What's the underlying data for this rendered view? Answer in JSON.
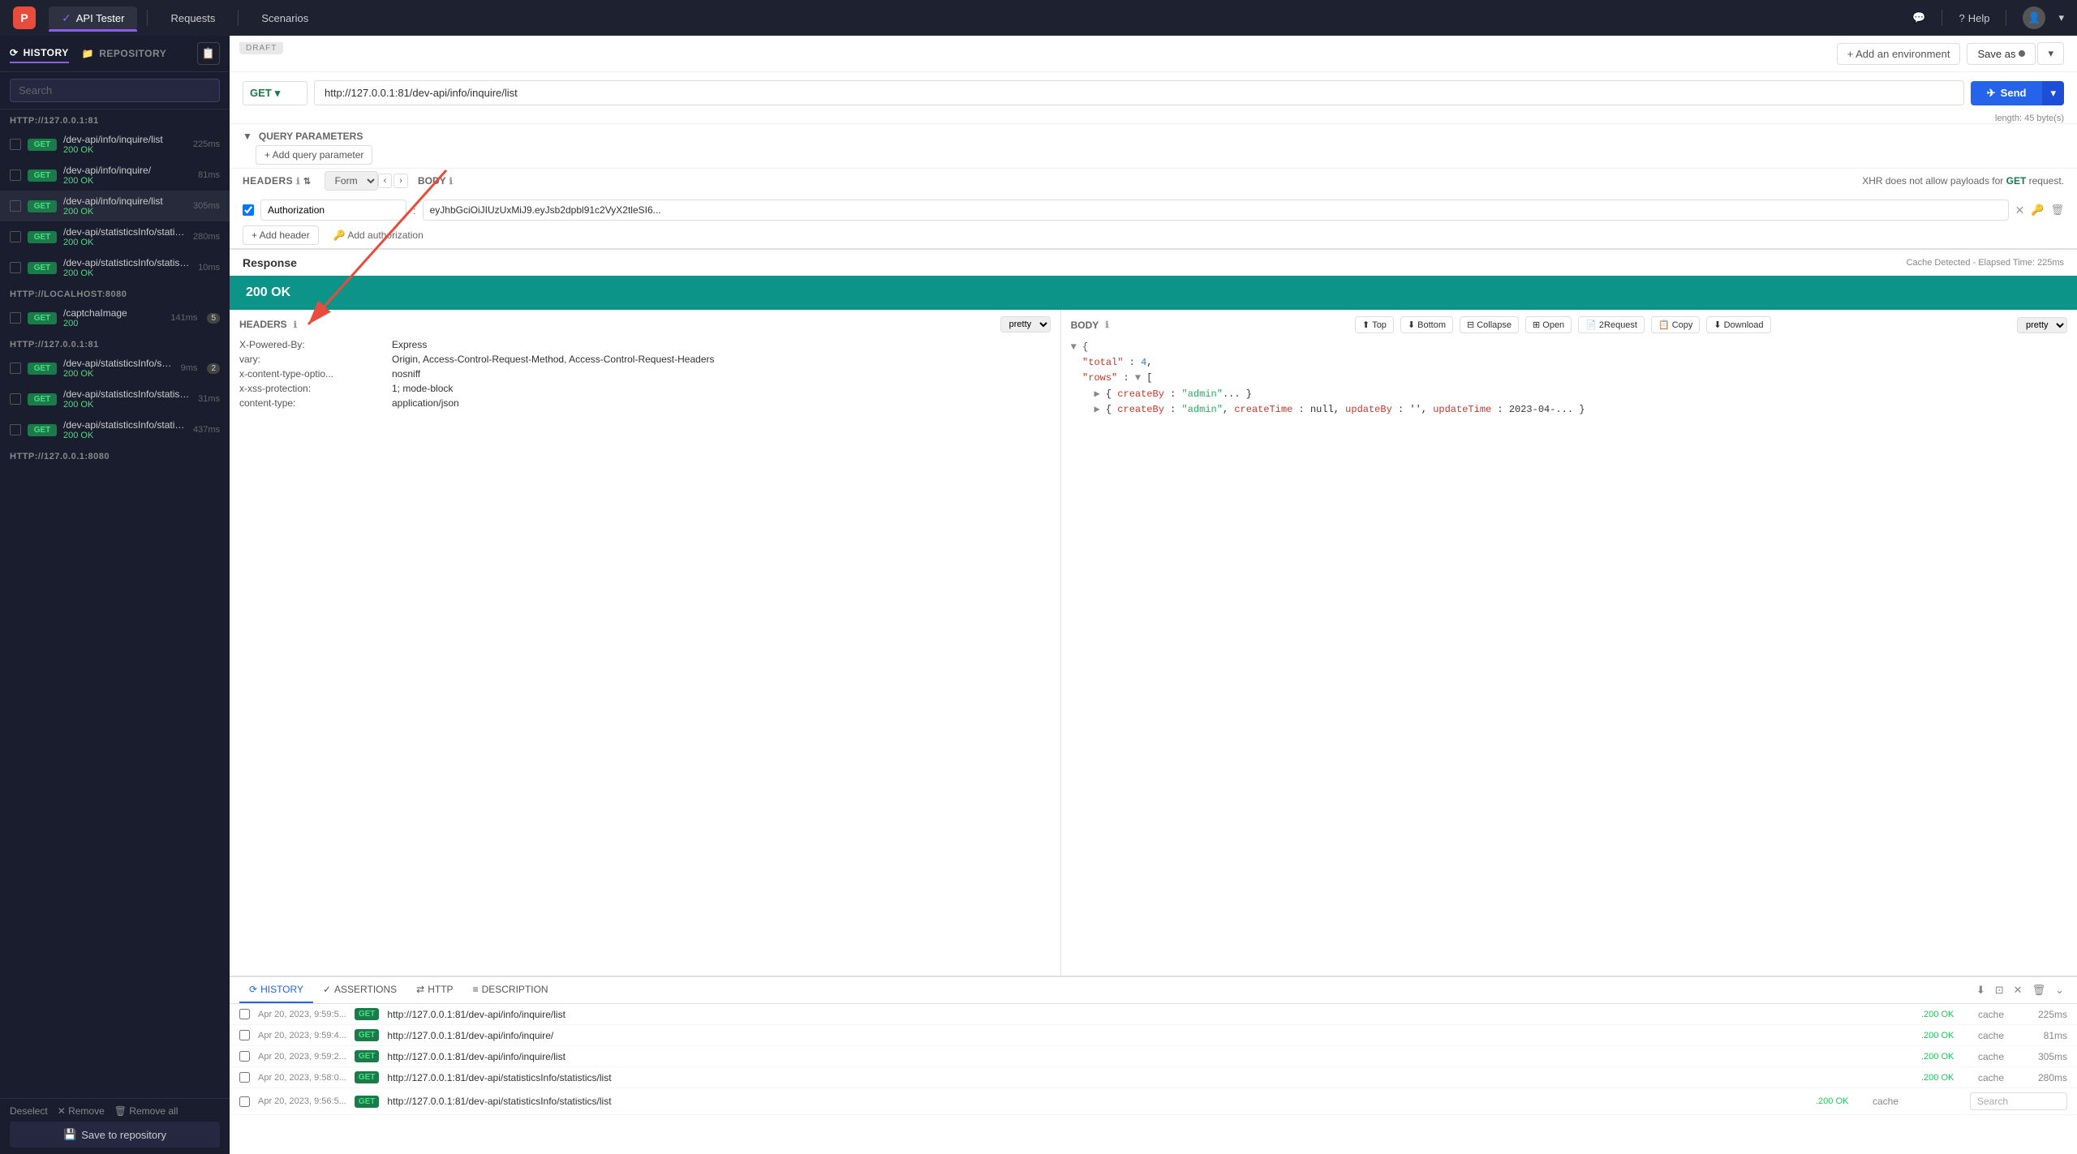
{
  "app": {
    "logo": "P",
    "nav_tabs": [
      {
        "id": "api-tester",
        "label": "API Tester",
        "active": true,
        "has_check": true
      },
      {
        "id": "requests",
        "label": "Requests",
        "active": false
      },
      {
        "id": "scenarios",
        "label": "Scenarios",
        "active": false
      }
    ],
    "nav_right": {
      "chat_icon": "💬",
      "help_label": "Help",
      "avatar_icon": "👤",
      "chevron": "▾"
    }
  },
  "sidebar": {
    "tabs": [
      {
        "id": "history",
        "label": "HISTORY",
        "active": true,
        "icon": "⟳"
      },
      {
        "id": "repository",
        "label": "REPOSITORY",
        "active": false,
        "icon": "📁"
      }
    ],
    "clipboard_icon": "📋",
    "search_placeholder": "Search",
    "groups": [
      {
        "header": "HTTP://127.0.0.1:81",
        "items": [
          {
            "path": "/dev-api/info/inquire/list",
            "method": "GET",
            "status": "200 OK",
            "time": "225ms",
            "checked": false
          },
          {
            "path": "/dev-api/info/inquire/",
            "method": "GET",
            "status": "200 OK",
            "time": "81ms",
            "checked": false
          },
          {
            "path": "/dev-api/info/inquire/list",
            "method": "GET",
            "status": "200 OK",
            "time": "305ms",
            "checked": false
          },
          {
            "path": "/dev-api/statisticsInfo/statistics/...",
            "method": "GET",
            "status": "200 OK",
            "time": "280ms",
            "checked": false
          },
          {
            "path": "/dev-api/statisticsInfo/statistics/...",
            "method": "GET",
            "status": "200 OK",
            "time": "10ms",
            "checked": false
          }
        ]
      },
      {
        "header": "HTTP://LOCALHOST:8080",
        "items": [
          {
            "path": "/captchaImage",
            "method": "GET",
            "status": "200",
            "time": "141ms",
            "badge": "5",
            "checked": false
          }
        ]
      },
      {
        "header": "HTTP://127.0.0.1:81",
        "items": [
          {
            "path": "/dev-api/statisticsInfo/statistics/...",
            "method": "GET",
            "status": "200 OK",
            "time": "9ms",
            "badge": "2",
            "checked": false
          },
          {
            "path": "/dev-api/statisticsInfo/statistics/...",
            "method": "GET",
            "status": "200 OK",
            "time": "31ms",
            "checked": false
          },
          {
            "path": "/dev-api/statisticsInfo/statistics/...",
            "method": "GET",
            "status": "200 OK",
            "time": "437ms",
            "checked": false
          }
        ]
      },
      {
        "header": "HTTP://127.0.0.1:8080",
        "items": []
      }
    ],
    "bottom_actions": {
      "deselect": "Deselect",
      "remove": "✕ Remove",
      "remove_all": "🗑 Remove all"
    },
    "save_to_repo_label": "Save to repository"
  },
  "request": {
    "draft_label": "DRAFT",
    "env_btn": "+ Add an environment",
    "save_as_label": "Save as",
    "method": "GET",
    "url": "http://127.0.0.1:81/dev-api/info/inquire/list",
    "url_length": "length: 45 byte(s)",
    "send_label": "Send",
    "query_params_label": "QUERY PARAMETERS",
    "add_query_param_label": "+ Add query parameter",
    "headers_label": "HEADERS",
    "form_label": "Form",
    "body_label": "BODY",
    "xhr_note": "XHR does not allow payloads for GET request.",
    "header_row": {
      "key": "Authorization",
      "value": "eyJhbGciOiJIUzUxMiJ9.eyJsb2dpbl91c2VyX2tleSI6..."
    },
    "add_header_label": "+ Add header",
    "add_authorization_label": "🔑 Add authorization"
  },
  "response": {
    "title": "Response",
    "cache_info": "Cache Detected - Elapsed Time: 225ms",
    "status_code": "200",
    "status_text": "OK",
    "headers_label": "HEADERS",
    "body_label": "BODY",
    "pretty_label": "pretty",
    "response_headers": [
      {
        "key": "X-Powered-By:",
        "value": "Express"
      },
      {
        "key": "vary:",
        "value": "Origin, Access-Control-Request-Method, Access-Control-Request-Headers"
      },
      {
        "key": "x-content-type-optio...",
        "value": "nosniff"
      },
      {
        "key": "x-xss-protection:",
        "value": "1; mode-block"
      },
      {
        "key": "content-type:",
        "value": "application/json"
      }
    ],
    "body_json": {
      "total": 4,
      "rows_preview": "[{ createBy: 'admin'... }, { createBy: 'admin', createTime: null, updateBy: '', updateTime: 2023-04-...}]"
    },
    "toolbar": {
      "top_label": "Top",
      "bottom_label": "Bottom",
      "collapse_label": "Collapse",
      "open_label": "Open",
      "request_label": "2Request",
      "copy_label": "Copy",
      "download_label": "Download"
    }
  },
  "bottom_panel": {
    "tabs": [
      {
        "id": "history",
        "label": "HISTORY",
        "icon": "⟳",
        "active": true
      },
      {
        "id": "assertions",
        "label": "ASSERTIONS",
        "icon": "✓",
        "active": false
      },
      {
        "id": "http",
        "label": "HTTP",
        "icon": "⇄",
        "active": false
      },
      {
        "id": "description",
        "label": "DESCRIPTION",
        "icon": "≡",
        "active": false
      }
    ],
    "history_rows": [
      {
        "date": "Apr 20, 2023, 9:59:5...",
        "method": "GET",
        "url": "http://127.0.0.1:81/dev-api/info/inquire/list",
        "status": ".200 OK",
        "cache": "cache",
        "time": "225ms"
      },
      {
        "date": "Apr 20, 2023, 9:59:4...",
        "method": "GET",
        "url": "http://127.0.0.1:81/dev-api/info/inquire/",
        "status": ".200 OK",
        "cache": "cache",
        "time": "81ms"
      },
      {
        "date": "Apr 20, 2023, 9:59:2...",
        "method": "GET",
        "url": "http://127.0.0.1:81/dev-api/info/inquire/list",
        "status": ".200 OK",
        "cache": "cache",
        "time": "305ms"
      },
      {
        "date": "Apr 20, 2023, 9:58:0...",
        "method": "GET",
        "url": "http://127.0.0.1:81/dev-api/statisticsInfo/statistics/list",
        "status": ".200 OK",
        "cache": "cache",
        "time": "280ms"
      },
      {
        "date": "Apr 20, 2023, 9:56:5...",
        "method": "GET",
        "url": "http://127.0.0.1:81/dev-api/statisticsInfo/statistics/list",
        "status": ".200 OK",
        "cache": "cache",
        "time": ""
      }
    ],
    "search_placeholder": "Search"
  }
}
